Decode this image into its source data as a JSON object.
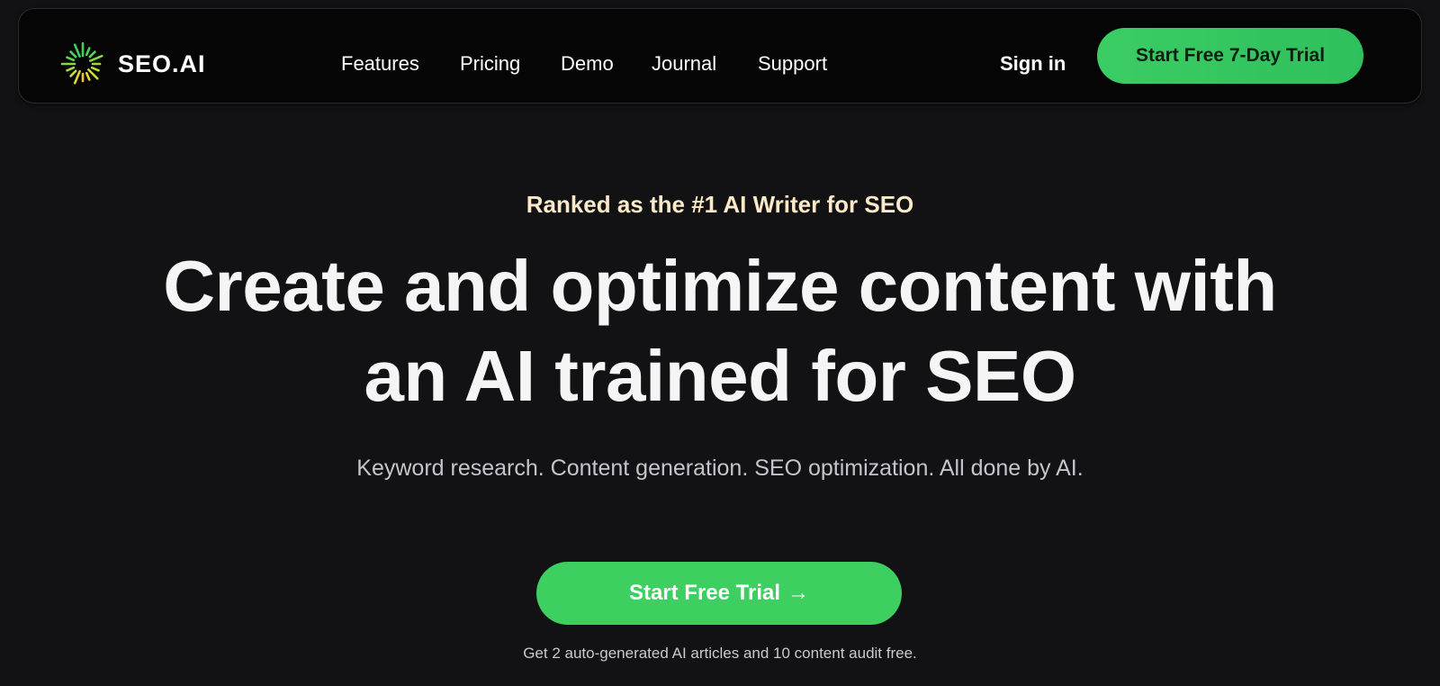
{
  "brand": {
    "name": "SEO.AI",
    "logo_icon": "sunburst-icon",
    "accent": "#3dcf5f"
  },
  "nav": {
    "items": [
      {
        "label": "Features"
      },
      {
        "label": "Pricing"
      },
      {
        "label": "Demo"
      },
      {
        "label": "Journal"
      },
      {
        "label": "Support"
      }
    ],
    "sign_in": "Sign in",
    "trial_cta": "Start Free 7-Day Trial"
  },
  "hero": {
    "eyebrow": "Ranked as the #1 AI Writer for SEO",
    "headline_line1": "Create and optimize content with",
    "headline_line2": "an AI trained for SEO",
    "subline": "Keyword research. Content generation. SEO optimization. All done by AI.",
    "cta_label": "Start Free Trial",
    "cta_icon": "arrow-right-icon",
    "footnote": "Get 2 auto-generated AI articles and 10 content audit free."
  },
  "colors": {
    "background": "#121214",
    "navbar": "#050505",
    "eyebrow": "#fbe9c8"
  }
}
